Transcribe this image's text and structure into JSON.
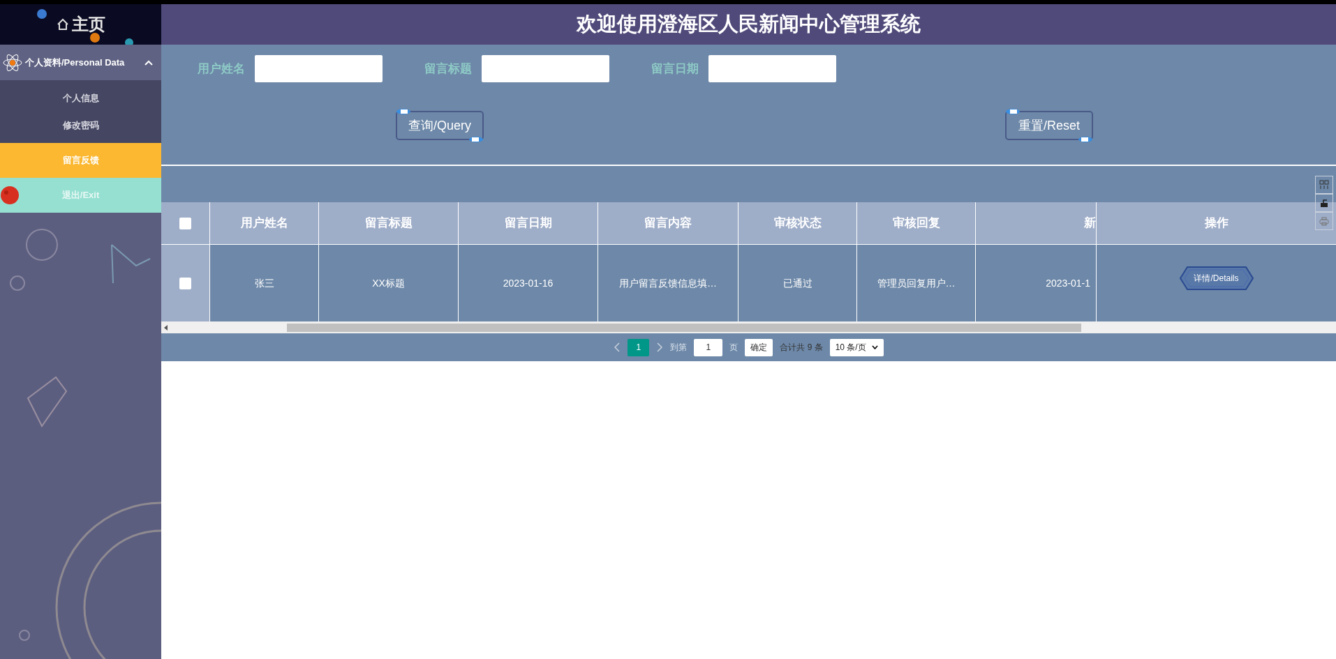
{
  "sidebar": {
    "home": "主页",
    "section": {
      "label": "个人资料/Personal Data",
      "expanded": true,
      "children": [
        {
          "label": "个人信息",
          "selected": false
        },
        {
          "label": "修改密码",
          "selected": false
        }
      ]
    },
    "items": [
      {
        "label": "留言反馈",
        "kind": "link",
        "selected": true
      },
      {
        "label": "退出/Exit",
        "kind": "exit",
        "selected": false
      }
    ]
  },
  "header": {
    "title": "欢迎使用澄海区人民新闻中心管理系统"
  },
  "search": {
    "fields": [
      {
        "label": "用户姓名"
      },
      {
        "label": "留言标题"
      },
      {
        "label": "留言日期"
      }
    ],
    "buttons": [
      "查询/Query",
      "重置/Reset"
    ]
  },
  "table": {
    "all_checked": false,
    "columns": [
      "用户姓名",
      "留言标题",
      "留言日期",
      "留言内容",
      "审核状态",
      "审核回复",
      "新"
    ],
    "action_column": "操作",
    "rows": [
      {
        "checked": false,
        "cells": [
          "张三",
          "XX标题",
          "2023-01-16",
          "用户留言反馈信息填…",
          "已通过",
          "管理员回复用户…",
          "2023-01-1"
        ],
        "action": "详情/Details"
      }
    ]
  },
  "pagination": {
    "current": "1",
    "goto_label": "到第",
    "page_input": "1",
    "page_unit": "页",
    "confirm": "确定",
    "total": "合计共 9 条",
    "page_size": "10 条/页"
  }
}
